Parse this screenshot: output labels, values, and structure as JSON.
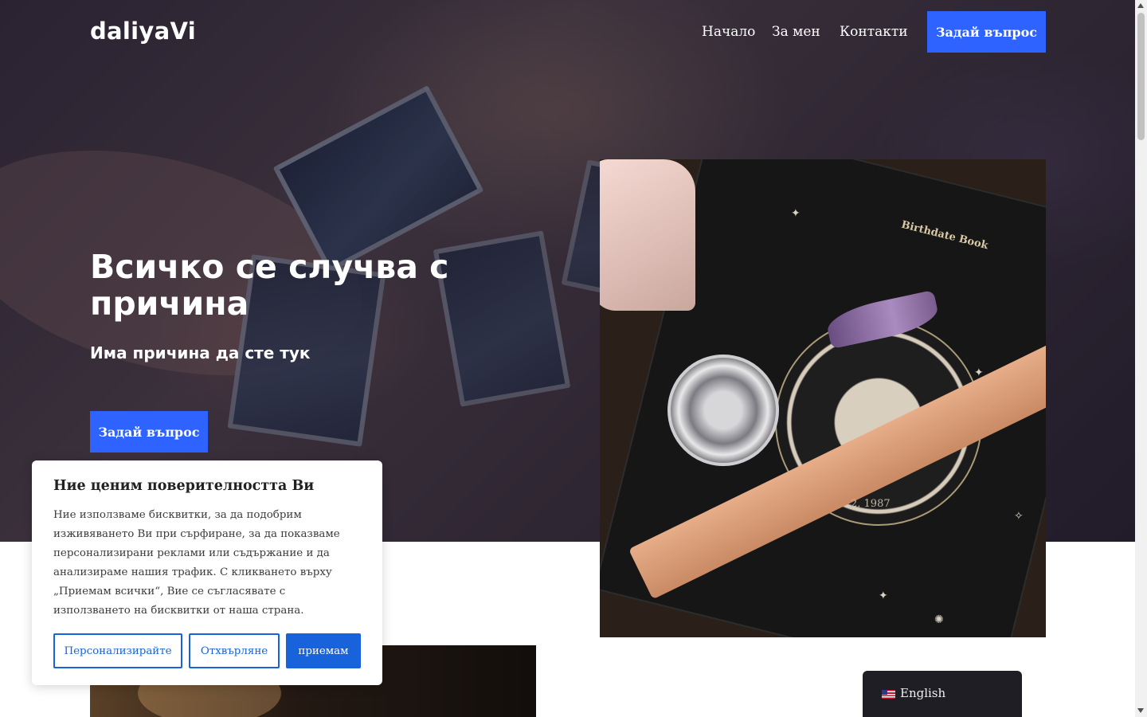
{
  "site": {
    "logo": "daliyaVi"
  },
  "nav": {
    "items": [
      {
        "label": "Начало"
      },
      {
        "label": "За мен"
      },
      {
        "label": "Контакти"
      }
    ],
    "cta_label": "Задай въпрос"
  },
  "hero": {
    "title": "Всичко се случва с причина",
    "subtitle": "Има причина да сте тук",
    "cta_label": "Задай въпрос"
  },
  "feature_image": {
    "book_title": "Birthdate Book",
    "visible_date": "2, 1987"
  },
  "cookie_banner": {
    "title": "Ние ценим поверителността Ви",
    "text": "Ние използваме бисквитки, за да подобрим изживяването Ви при сърфиране, за да показваме персонализирани реклами или съдържание и да анализираме нашия трафик. С кликването върху „Приемам всички“, Вие се съгласявате с използването на бисквитки от наша страна.",
    "buttons": {
      "customize": "Персонализирайте",
      "reject": "Отхвърляне",
      "accept": "приемам"
    }
  },
  "language_switcher": {
    "label": "English",
    "flag_icon": "us-flag-icon"
  },
  "colors": {
    "primary_button": "#2f63ff",
    "cookie_accent": "#1863dc",
    "lang_bg": "#1e1e24"
  }
}
